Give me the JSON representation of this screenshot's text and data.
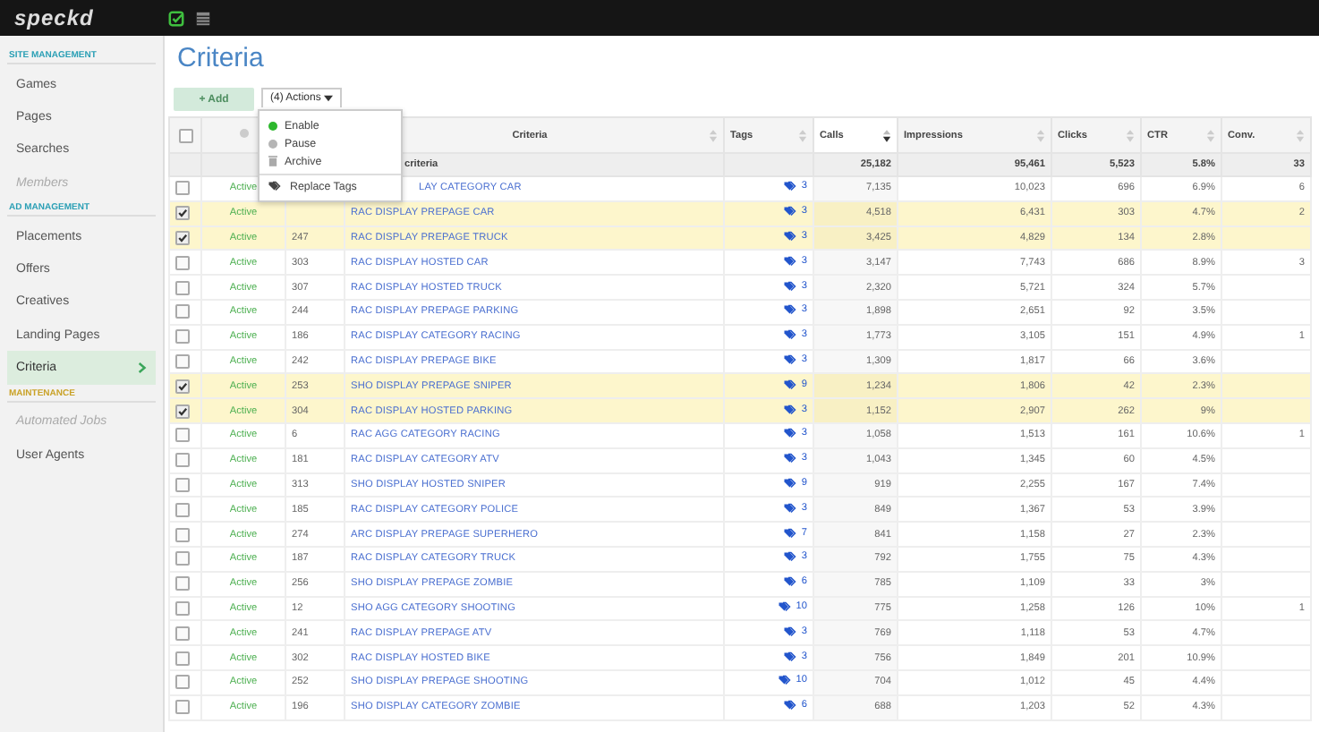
{
  "logo": "speckd",
  "sidebar": [
    {
      "heading": "SITE MANAGEMENT",
      "color": "#2a9fb5",
      "items": [
        {
          "label": "Games",
          "disabled": false,
          "selected": false
        },
        {
          "label": "Pages",
          "disabled": false,
          "selected": false
        },
        {
          "label": "Searches",
          "disabled": false,
          "selected": false
        },
        {
          "label": "Members",
          "disabled": true,
          "selected": false
        }
      ]
    },
    {
      "heading": "AD MANAGEMENT",
      "color": "#2a9fb5",
      "items": [
        {
          "label": "Placements",
          "disabled": false,
          "selected": false
        },
        {
          "label": "Offers",
          "disabled": false,
          "selected": false
        },
        {
          "label": "Creatives",
          "disabled": false,
          "selected": false
        },
        {
          "label": "Landing Pages",
          "disabled": false,
          "selected": false
        },
        {
          "label": "Criteria",
          "disabled": false,
          "selected": true
        }
      ]
    },
    {
      "heading": "MAINTENANCE",
      "color": "#c9a227",
      "items": [
        {
          "label": "Automated Jobs",
          "disabled": true,
          "selected": false
        },
        {
          "label": "User Agents",
          "disabled": false,
          "selected": false
        }
      ]
    }
  ],
  "title": "Criteria",
  "add_button": {
    "label": "+ Add",
    "disabled": true
  },
  "actions_button": {
    "label": "(4) Actions"
  },
  "actions_menu": [
    {
      "label": "Enable",
      "kind": "dot",
      "color": "#2db82d"
    },
    {
      "label": "Pause",
      "kind": "dot",
      "color": "#b5b5b5"
    },
    {
      "label": "Archive",
      "kind": "trash"
    },
    {
      "label": "Replace Tags",
      "kind": "tags"
    }
  ],
  "columns": [
    "Criteria",
    "Tags",
    "Calls",
    "Impressions",
    "Clicks",
    "CTR",
    "Conv."
  ],
  "select_all": {
    "checked": false
  },
  "filter_text": "criteria",
  "totals": {
    "calls": "25,182",
    "impressions": "95,461",
    "clicks": "5,523",
    "ctr": "5.8%",
    "conv": "33"
  },
  "rows": [
    {
      "checked": false,
      "status": "Active",
      "criteria": "LAY CATEGORY CAR",
      "tags": "3",
      "calls": "7,135",
      "impressions": "10,023",
      "clicks": "696",
      "ctr": "6.9%",
      "conv": "6"
    },
    {
      "checked": true,
      "status": "Active",
      "criteria": "RAC DISPLAY PREPAGE CAR",
      "tags": "3",
      "calls": "4,518",
      "impressions": "6,431",
      "clicks": "303",
      "ctr": "4.7%",
      "conv": "2"
    },
    {
      "checked": true,
      "status": "Active",
      "id": "247",
      "criteria": "RAC DISPLAY PREPAGE TRUCK",
      "tags": "3",
      "calls": "3,425",
      "impressions": "4,829",
      "clicks": "134",
      "ctr": "2.8%"
    },
    {
      "checked": false,
      "status": "Active",
      "id": "303",
      "criteria": "RAC DISPLAY HOSTED CAR",
      "tags": "3",
      "calls": "3,147",
      "impressions": "7,743",
      "clicks": "686",
      "ctr": "8.9%",
      "conv": "3"
    },
    {
      "checked": false,
      "status": "Active",
      "id": "307",
      "criteria": "RAC DISPLAY HOSTED TRUCK",
      "tags": "3",
      "calls": "2,320",
      "impressions": "5,721",
      "clicks": "324",
      "ctr": "5.7%"
    },
    {
      "checked": false,
      "status": "Active",
      "id": "244",
      "criteria": "RAC DISPLAY PREPAGE PARKING",
      "tags": "3",
      "calls": "1,898",
      "impressions": "2,651",
      "clicks": "92",
      "ctr": "3.5%"
    },
    {
      "checked": false,
      "status": "Active",
      "id": "186",
      "criteria": "RAC DISPLAY CATEGORY RACING",
      "tags": "3",
      "calls": "1,773",
      "impressions": "3,105",
      "clicks": "151",
      "ctr": "4.9%",
      "conv": "1"
    },
    {
      "checked": false,
      "status": "Active",
      "id": "242",
      "criteria": "RAC DISPLAY PREPAGE BIKE",
      "tags": "3",
      "calls": "1,309",
      "impressions": "1,817",
      "clicks": "66",
      "ctr": "3.6%"
    },
    {
      "checked": true,
      "status": "Active",
      "id": "253",
      "criteria": "SHO DISPLAY PREPAGE SNIPER",
      "tags": "9",
      "calls": "1,234",
      "impressions": "1,806",
      "clicks": "42",
      "ctr": "2.3%"
    },
    {
      "checked": true,
      "status": "Active",
      "id": "304",
      "criteria": "RAC DISPLAY HOSTED PARKING",
      "tags": "3",
      "calls": "1,152",
      "impressions": "2,907",
      "clicks": "262",
      "ctr": "9%"
    },
    {
      "checked": false,
      "status": "Active",
      "id": "6",
      "criteria": "RAC AGG CATEGORY RACING",
      "tags": "3",
      "calls": "1,058",
      "impressions": "1,513",
      "clicks": "161",
      "ctr": "10.6%",
      "conv": "1"
    },
    {
      "checked": false,
      "status": "Active",
      "id": "181",
      "criteria": "RAC DISPLAY CATEGORY ATV",
      "tags": "3",
      "calls": "1,043",
      "impressions": "1,345",
      "clicks": "60",
      "ctr": "4.5%"
    },
    {
      "checked": false,
      "status": "Active",
      "id": "313",
      "criteria": "SHO DISPLAY HOSTED SNIPER",
      "tags": "9",
      "calls": "919",
      "impressions": "2,255",
      "clicks": "167",
      "ctr": "7.4%"
    },
    {
      "checked": false,
      "status": "Active",
      "id": "185",
      "criteria": "RAC DISPLAY CATEGORY POLICE",
      "tags": "3",
      "calls": "849",
      "impressions": "1,367",
      "clicks": "53",
      "ctr": "3.9%"
    },
    {
      "checked": false,
      "status": "Active",
      "id": "274",
      "criteria": "ARC DISPLAY PREPAGE SUPERHERO",
      "tags": "7",
      "calls": "841",
      "impressions": "1,158",
      "clicks": "27",
      "ctr": "2.3%"
    },
    {
      "checked": false,
      "status": "Active",
      "id": "187",
      "criteria": "RAC DISPLAY CATEGORY TRUCK",
      "tags": "3",
      "calls": "792",
      "impressions": "1,755",
      "clicks": "75",
      "ctr": "4.3%"
    },
    {
      "checked": false,
      "status": "Active",
      "id": "256",
      "criteria": "SHO DISPLAY PREPAGE ZOMBIE",
      "tags": "6",
      "calls": "785",
      "impressions": "1,109",
      "clicks": "33",
      "ctr": "3%"
    },
    {
      "checked": false,
      "status": "Active",
      "id": "12",
      "criteria": "SHO AGG CATEGORY SHOOTING",
      "tags": "10",
      "calls": "775",
      "impressions": "1,258",
      "clicks": "126",
      "ctr": "10%",
      "conv": "1"
    },
    {
      "checked": false,
      "status": "Active",
      "id": "241",
      "criteria": "RAC DISPLAY PREPAGE ATV",
      "tags": "3",
      "calls": "769",
      "impressions": "1,118",
      "clicks": "53",
      "ctr": "4.7%"
    },
    {
      "checked": false,
      "status": "Active",
      "id": "302",
      "criteria": "RAC DISPLAY HOSTED BIKE",
      "tags": "3",
      "calls": "756",
      "impressions": "1,849",
      "clicks": "201",
      "ctr": "10.9%"
    },
    {
      "checked": false,
      "status": "Active",
      "id": "252",
      "criteria": "SHO DISPLAY PREPAGE SHOOTING",
      "tags": "10",
      "calls": "704",
      "impressions": "1,012",
      "clicks": "45",
      "ctr": "4.4%"
    },
    {
      "checked": false,
      "status": "Active",
      "id": "196",
      "criteria": "SHO DISPLAY CATEGORY ZOMBIE",
      "tags": "6",
      "calls": "688",
      "impressions": "1,203",
      "clicks": "52",
      "ctr": "4.3%"
    }
  ]
}
